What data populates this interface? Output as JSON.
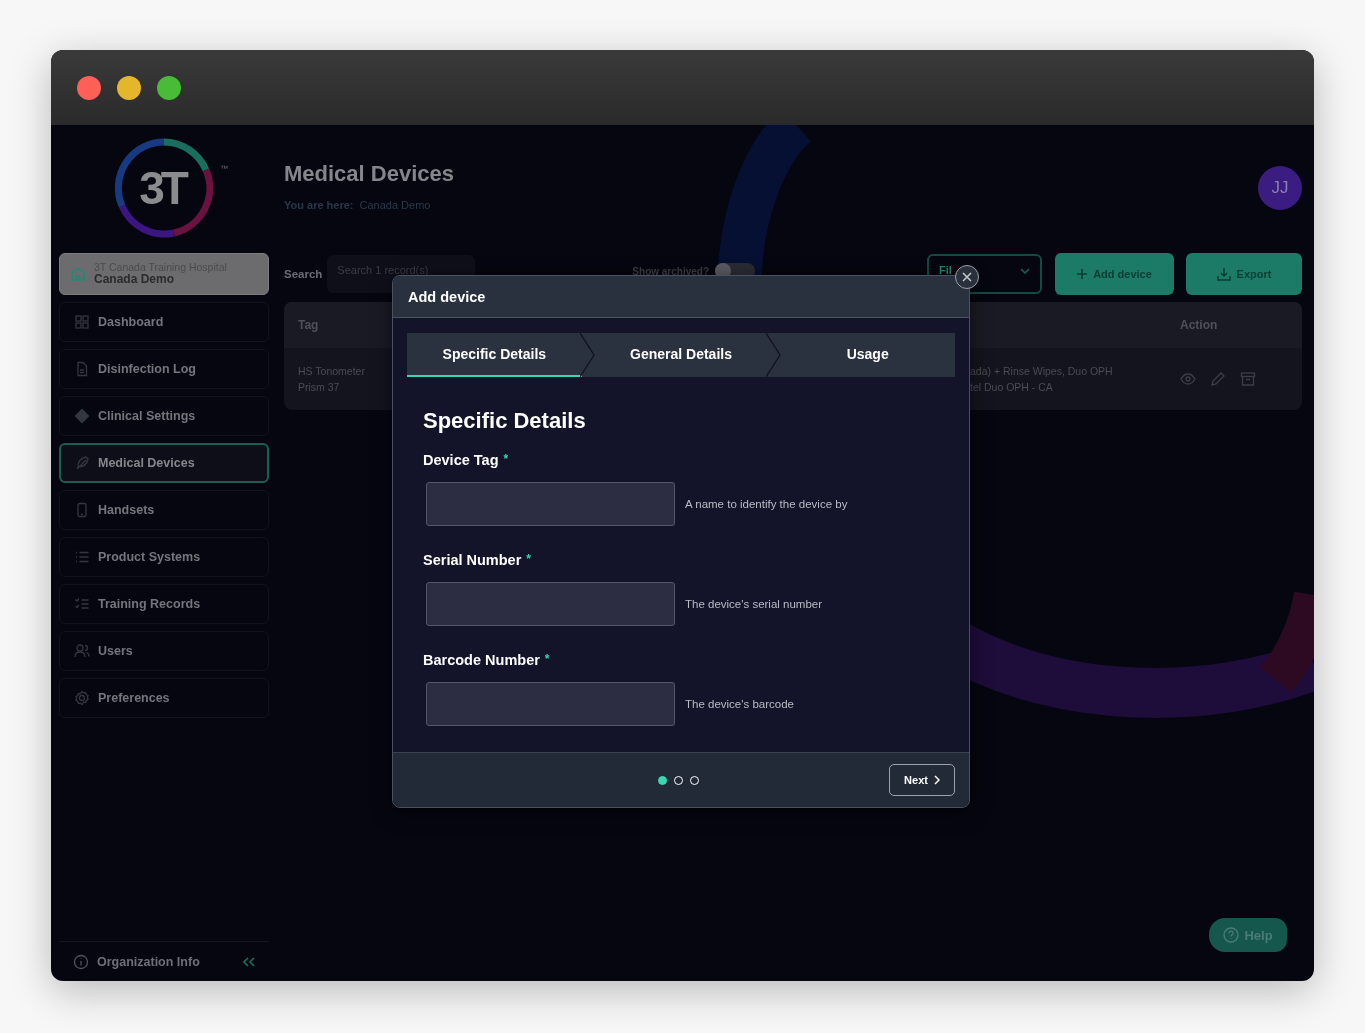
{
  "logo": {
    "text": "3T",
    "mark": "™"
  },
  "sidebar": {
    "organization": {
      "line1": "3T Canada Training Hospital",
      "line2": "Canada Demo"
    },
    "items": [
      {
        "label": "Dashboard",
        "kind": "grid",
        "selected": false
      },
      {
        "label": "Disinfection Log",
        "kind": "document",
        "selected": false
      },
      {
        "label": "Clinical Settings",
        "kind": "diamond",
        "selected": false
      },
      {
        "label": "Medical Devices",
        "kind": "feather",
        "selected": true
      },
      {
        "label": "Handsets",
        "kind": "phone",
        "selected": false
      },
      {
        "label": "Product Systems",
        "kind": "list",
        "selected": false
      },
      {
        "label": "Training Records",
        "kind": "checklist",
        "selected": false
      },
      {
        "label": "Users",
        "kind": "users",
        "selected": false
      },
      {
        "label": "Preferences",
        "kind": "gear",
        "selected": false
      }
    ],
    "footer": {
      "label": "Organization Info"
    }
  },
  "header": {
    "title": "Medical Devices",
    "breadcrumb_label": "You are here:",
    "breadcrumb": "Canada Demo",
    "avatar": "JJ"
  },
  "toolbar": {
    "search_label": "Search",
    "search": {
      "placeholder": "Search 1 record(s)"
    },
    "archived_label": "Show archived?",
    "archived_on": false,
    "filter": "Fil",
    "add_button": "Add device",
    "export_button": "Export"
  },
  "table": {
    "columns": [
      {
        "label": "Tag"
      },
      {
        "label": "Action"
      }
    ],
    "rows": [
      {
        "tag": "HS Tonometer Prism 37",
        "description": [
          "ada) + Rinse Wipes, Duo OPH",
          "tel Duo OPH - CA"
        ]
      }
    ]
  },
  "modal": {
    "title": "Add device",
    "steps": [
      {
        "label": "Specific Details",
        "selected": true
      },
      {
        "label": "General Details",
        "selected": false
      },
      {
        "label": "Usage",
        "selected": false
      }
    ],
    "heading": "Specific Details",
    "fields": [
      {
        "label": "Device Tag",
        "required_mark": "*",
        "hint": "A name to identify the device by"
      },
      {
        "label": "Serial Number",
        "required_mark": "*",
        "hint": "The device's serial number"
      },
      {
        "label": "Barcode Number",
        "required_mark": "*",
        "hint": "The device's barcode"
      }
    ],
    "pages": [
      {
        "selected": true
      },
      {
        "selected": false
      },
      {
        "selected": false
      }
    ],
    "next_button": "Next"
  },
  "help_button": "Help"
}
